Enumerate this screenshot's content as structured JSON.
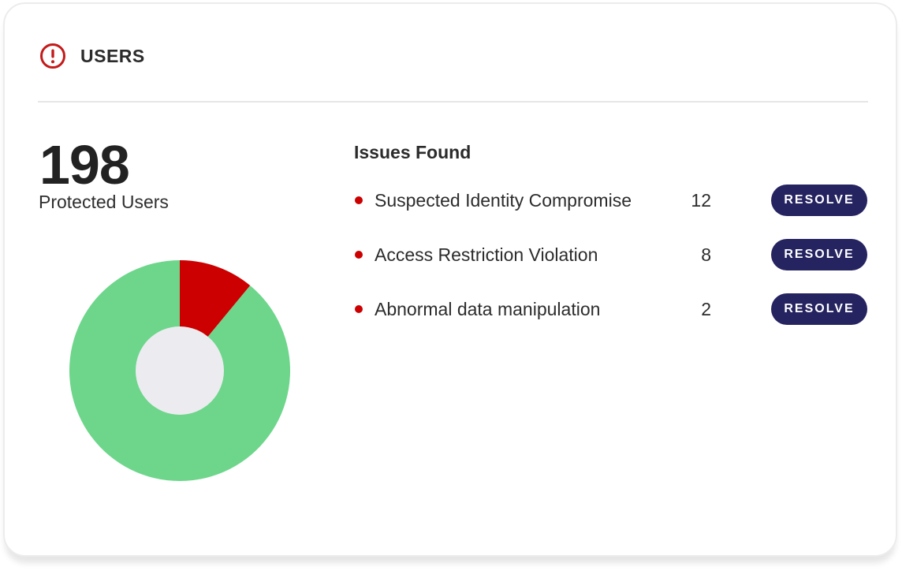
{
  "header": {
    "icon": "alert-circle-icon",
    "title": "USERS"
  },
  "summary": {
    "value": "198",
    "label": "Protected Users"
  },
  "issues": {
    "title": "Issues Found",
    "items": [
      {
        "label": "Suspected Identity Compromise",
        "count": "12",
        "action": "RESOLVE"
      },
      {
        "label": "Access Restriction Violation",
        "count": "8",
        "action": "RESOLVE"
      },
      {
        "label": "Abnormal data manipulation",
        "count": "2",
        "action": "RESOLVE"
      }
    ]
  },
  "chart_data": {
    "type": "pie",
    "slices": [
      {
        "value": 11,
        "color": "#cc0000"
      },
      {
        "value": 89,
        "color": "#6dd68b"
      }
    ]
  },
  "colors": {
    "accent_red": "#cc0000",
    "healthy_green": "#6dd68b",
    "button_navy": "#252360",
    "donut_hole": "#ececf0"
  }
}
